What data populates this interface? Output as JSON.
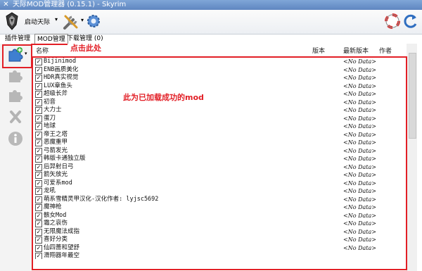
{
  "window": {
    "title": "天际MOD管理器 (0.15.1) - Skyrim"
  },
  "toolbar": {
    "launch_label": "启动天际",
    "launch_dropdown": "▾"
  },
  "tabs": [
    {
      "label": "插件管理"
    },
    {
      "label": "MOD管理"
    },
    {
      "label": "下载管理 (0)"
    }
  ],
  "columns": {
    "name": "名称",
    "version": "版本",
    "latest_version": "最新版本",
    "author": "作者"
  },
  "mods": [
    {
      "name": "Bijinimod",
      "latest": "<No Data>"
    },
    {
      "name": "ENB画质美化",
      "latest": "<No Data>"
    },
    {
      "name": "HDR真实视觉",
      "latest": "<No Data>"
    },
    {
      "name": "LUX章鱼头",
      "latest": "<No Data>"
    },
    {
      "name": "超级长斧",
      "latest": "<No Data>"
    },
    {
      "name": "初音",
      "latest": "<No Data>"
    },
    {
      "name": "大力士",
      "latest": "<No Data>"
    },
    {
      "name": "蛋刀",
      "latest": "<No Data>"
    },
    {
      "name": "地球",
      "latest": "<No Data>"
    },
    {
      "name": "帝王之塔",
      "latest": "<No Data>"
    },
    {
      "name": "恶魔重甲",
      "latest": "<No Data>"
    },
    {
      "name": "弓箭发光",
      "latest": "<No Data>"
    },
    {
      "name": "韩版卡通独立版",
      "latest": "<No Data>"
    },
    {
      "name": "后羿射日弓",
      "latest": "<No Data>"
    },
    {
      "name": "箭矢放光",
      "latest": "<No Data>"
    },
    {
      "name": "可爱系mod",
      "latest": "<No Data>"
    },
    {
      "name": "龙吼",
      "latest": "<No Data>"
    },
    {
      "name": "萌系雪精灵甲汉化-汉化作者: lyjsc5692",
      "latest": "<No Data>"
    },
    {
      "name": "魔神枪",
      "latest": "<No Data>"
    },
    {
      "name": "骸女Mod",
      "latest": "<No Data>"
    },
    {
      "name": "霜之哀伤",
      "latest": "<No Data>"
    },
    {
      "name": "无限魔法成指",
      "latest": "<No Data>"
    },
    {
      "name": "喜好分类",
      "latest": "<No Data>"
    },
    {
      "name": "仙四薔和望舒",
      "latest": "<No Data>"
    },
    {
      "name": "滑翔器年最空",
      "latest": ""
    }
  ],
  "annotations": {
    "click_here": "点击此处",
    "loaded_mods": "此为已加载成功的mod"
  },
  "colors": {
    "annotation": "#e21f26",
    "titlebar": "#6e96cc"
  }
}
